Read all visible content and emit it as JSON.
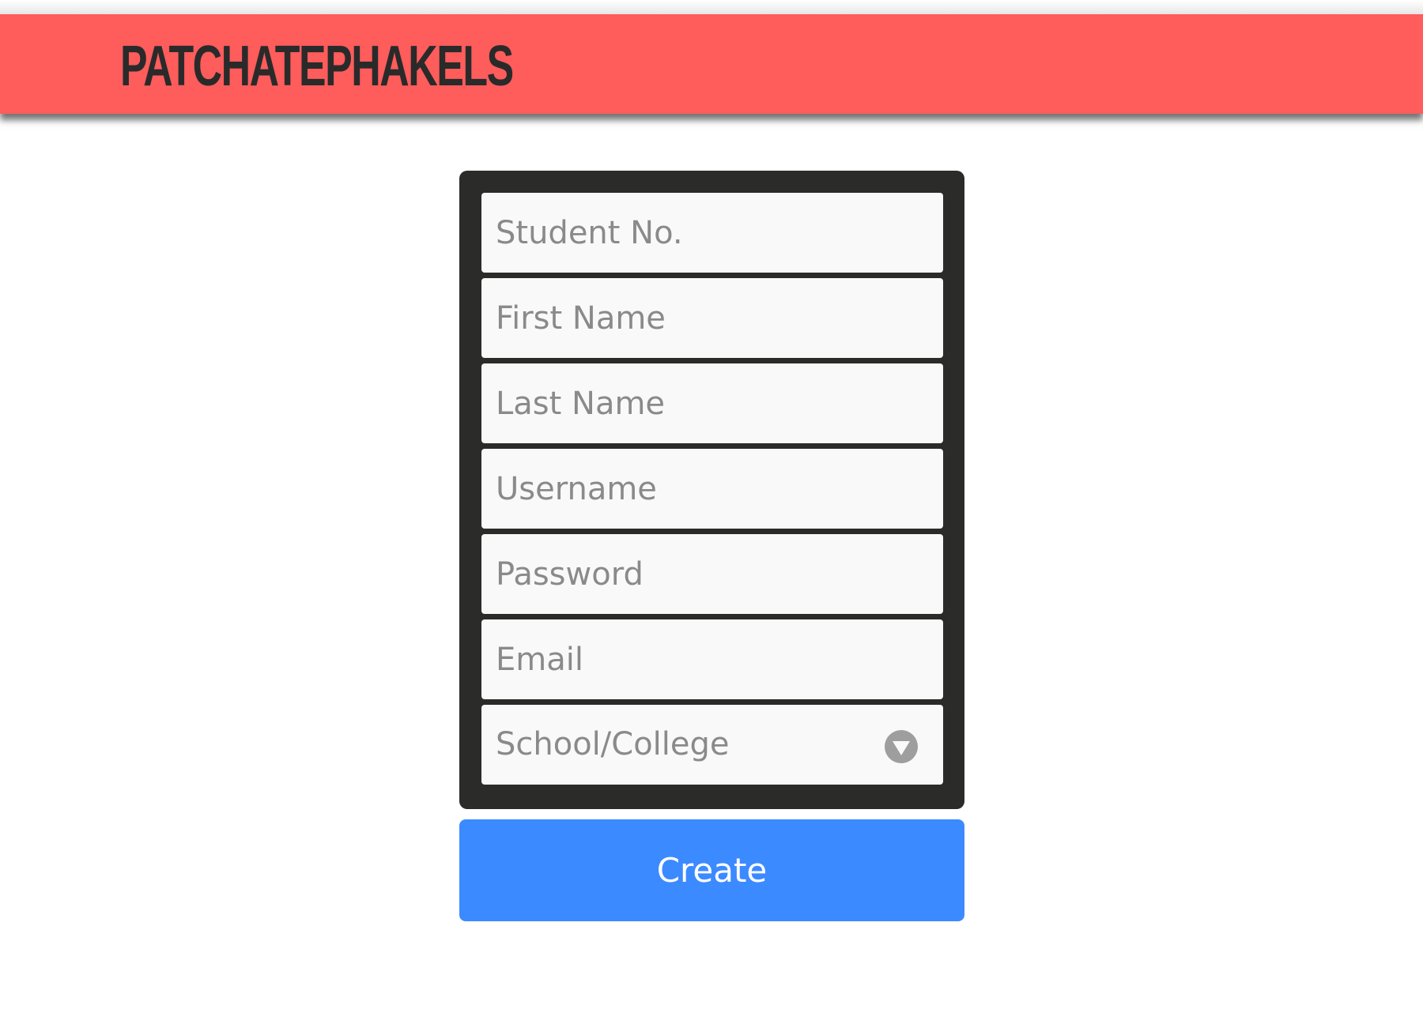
{
  "header": {
    "brand": "PATCHATEPHAKELS"
  },
  "form": {
    "fields": [
      {
        "placeholder": "Student No.",
        "type": "text"
      },
      {
        "placeholder": "First Name",
        "type": "text"
      },
      {
        "placeholder": "Last Name",
        "type": "text"
      },
      {
        "placeholder": "Username",
        "type": "text"
      },
      {
        "placeholder": "Password",
        "type": "password"
      },
      {
        "placeholder": "Email",
        "type": "email"
      }
    ],
    "select": {
      "placeholder": "School/College",
      "icon": "chevron-down-circle-icon"
    },
    "submit_label": "Create"
  },
  "colors": {
    "header_bg": "#ff5c5c",
    "panel_bg": "#2b2c2a",
    "button_bg": "#3c8aff"
  }
}
